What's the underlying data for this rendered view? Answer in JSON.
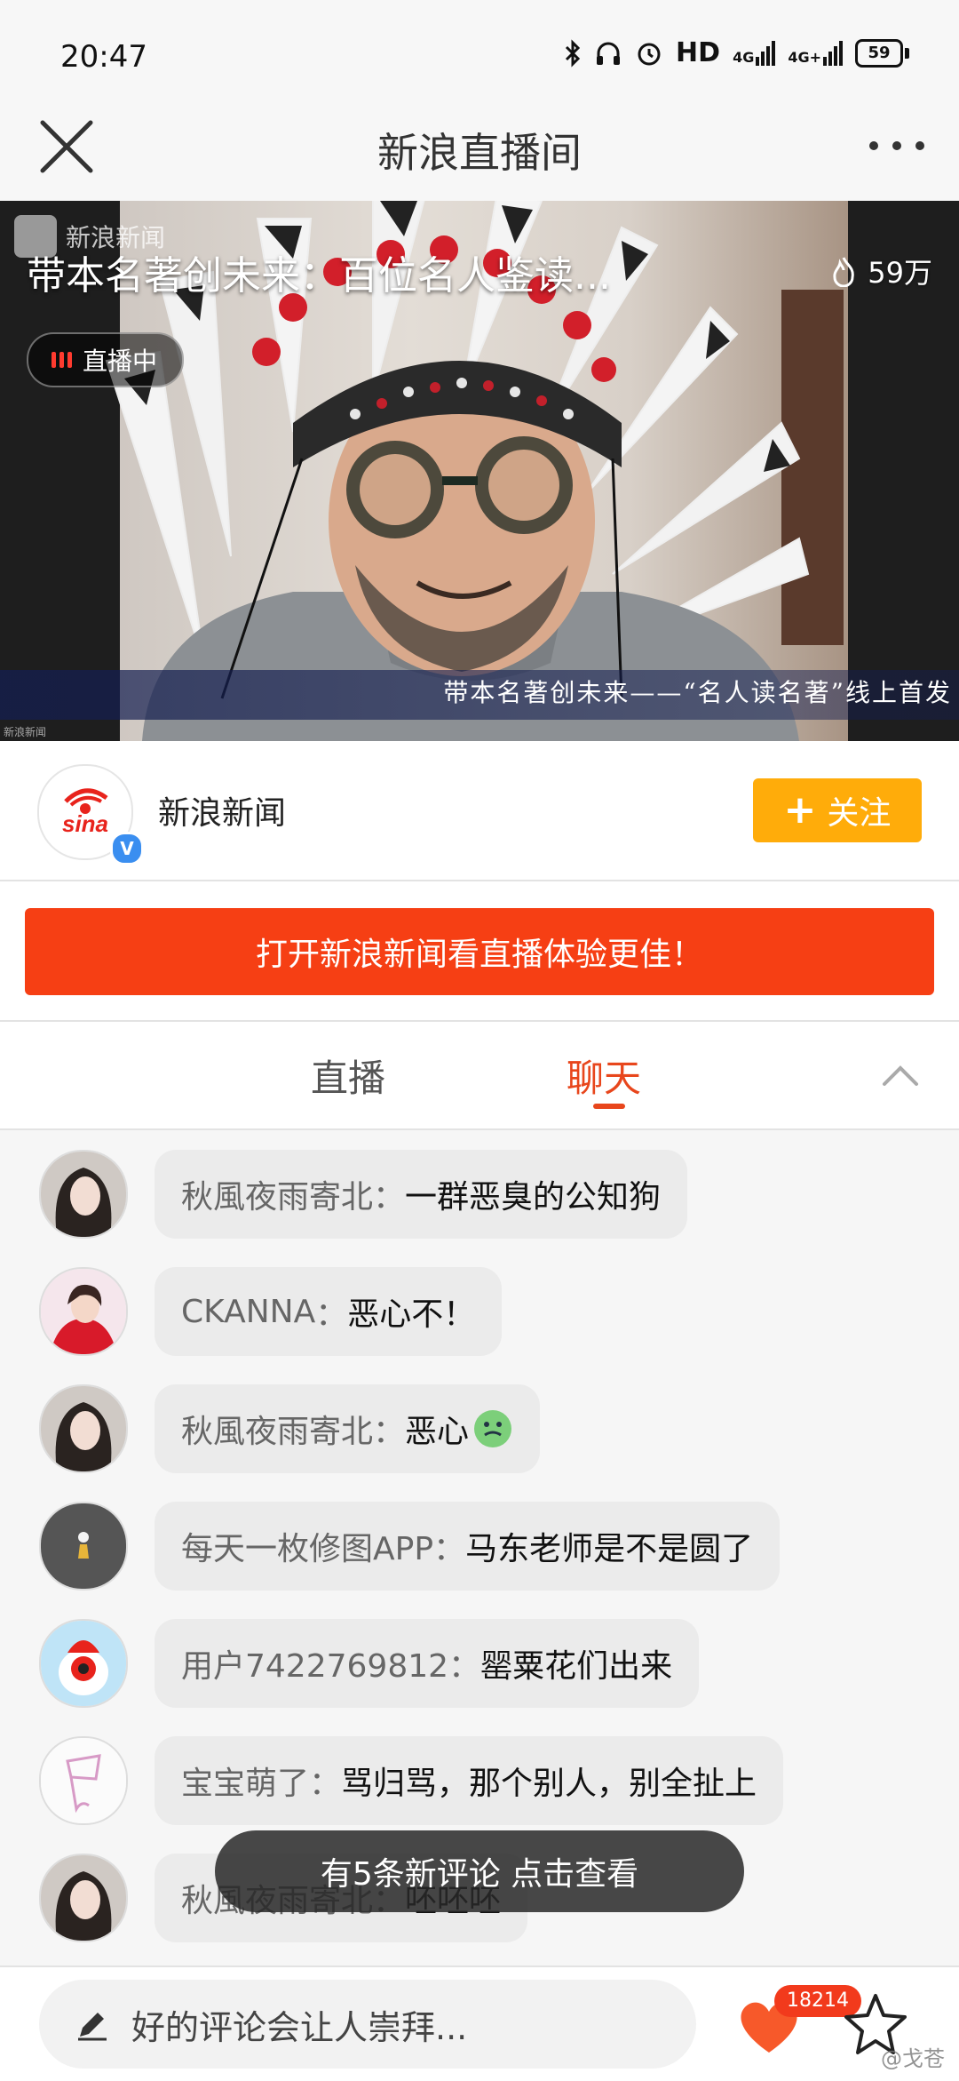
{
  "status_bar": {
    "time": "20:47",
    "network": "HD",
    "signal_1": "4G",
    "signal_2": "4G+",
    "battery": "59",
    "icons": [
      "bluetooth-icon",
      "headphones-icon",
      "alarm-icon",
      "signal-icon",
      "signal-icon",
      "battery-icon"
    ]
  },
  "header": {
    "title": "新浪直播间",
    "icons": [
      "close-icon",
      "more-dots-icon"
    ]
  },
  "video": {
    "brand": "新浪新闻",
    "title": "带本名著创未来：百位名人鉴读...",
    "viewer_count": "59万",
    "live_badge": "直播中",
    "caption": "带本名著创未来——“名人读名著”线上首发",
    "watermark": "新浪新闻"
  },
  "account": {
    "name": "新浪新闻",
    "verified_mark": "V",
    "follow_label": "关注",
    "follow_plus": "+"
  },
  "promo": {
    "label": "打开新浪新闻看直播体验更佳！"
  },
  "tabs": {
    "live": "直播",
    "chat": "聊天",
    "active": "chat"
  },
  "chat": {
    "messages": [
      {
        "user": "秋風夜雨寄北",
        "text": "一群恶臭的公知狗",
        "avatar": "woman-portrait"
      },
      {
        "user": "CKANNA",
        "text": "恶心不！",
        "avatar": "woman-red"
      },
      {
        "user": "秋風夜雨寄北",
        "text": "恶心",
        "emoji": "sick-face-emoji",
        "avatar": "woman-portrait"
      },
      {
        "user": "每天一枚修图APP",
        "text": "马东老师是不是圆了",
        "avatar": "dark-circle-figure"
      },
      {
        "user": "用户7422769812",
        "text": "罂粟花们出来",
        "avatar": "sina-eye-mascot"
      },
      {
        "user": "宝宝萌了",
        "text": "骂归骂，那个别人，别全扯上",
        "avatar": "pink-sketch"
      },
      {
        "user": "秋風夜雨寄北",
        "text": "呸呸呸",
        "avatar": "woman-portrait"
      }
    ],
    "separator": "："
  },
  "toast": {
    "text": "有5条新评论 点击查看"
  },
  "bottom_bar": {
    "placeholder": "好的评论会让人崇拜...",
    "like_count": "18214",
    "icons": [
      "pencil-icon",
      "heart-icon",
      "star-icon"
    ]
  },
  "colors": {
    "accent": "#e8461c",
    "follow": "#ffac0a",
    "promo": "#f63f14",
    "like_badge": "#f23a1c"
  },
  "corner_watermark": "@戈苍"
}
